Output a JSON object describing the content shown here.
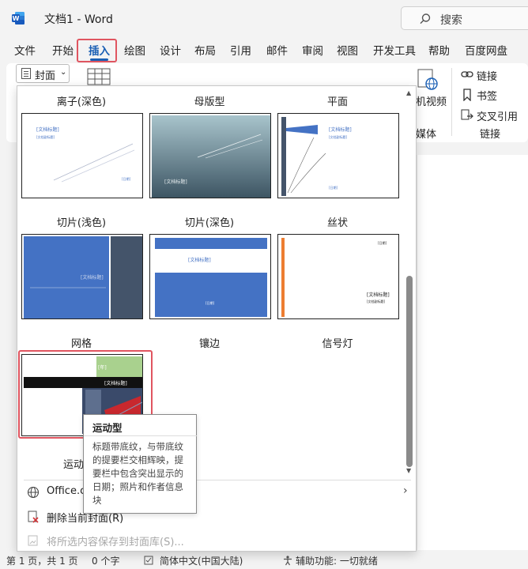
{
  "window": {
    "doc_title": "文档1  -  Word",
    "search_label": "搜索"
  },
  "tabs": [
    "文件",
    "开始",
    "插入",
    "绘图",
    "设计",
    "布局",
    "引用",
    "邮件",
    "审阅",
    "视图",
    "开发工具",
    "帮助",
    "百度网盘"
  ],
  "ribbon": {
    "cover_label": "封面",
    "media_btn": "机视频",
    "media_group": "媒体",
    "link_label": "链接",
    "bookmark_label": "书签",
    "crossref_label": "交叉引用",
    "links_group": "链接"
  },
  "gallery": {
    "names": [
      "离子(深色)",
      "母版型",
      "平面",
      "切片(浅色)",
      "切片(深色)",
      "丝状",
      "网格",
      "镶边",
      "信号灯"
    ],
    "placeholder_title": "[文档标题]",
    "placeholder_sub": "[文档副标题]",
    "placeholder_date": "[日期]",
    "placeholder_year": "[年]",
    "motion_partial": "运动"
  },
  "menu": {
    "office_label": "Office.co",
    "delete_label": "删除当前封面(R)",
    "save_label": "将所选内容保存到封面库(S)..."
  },
  "tooltip": {
    "title": "运动型",
    "body": "标题带底纹，与带底纹的提要栏交相辉映，提要栏中包含突出显示的日期；照片和作者信息块"
  },
  "status": {
    "page": "第 1 页，共 1 页",
    "words": "0 个字",
    "language": "简体中文(中国大陆)",
    "accessibility": "辅助功能: 一切就绪"
  },
  "colors": {
    "accent": "#1a5fb4",
    "highlight": "#e05560",
    "cover_blue": "#4472c4",
    "cover_slate": "#44546a",
    "cover_green": "#a9d18e",
    "cover_orange": "#ed7d31"
  }
}
